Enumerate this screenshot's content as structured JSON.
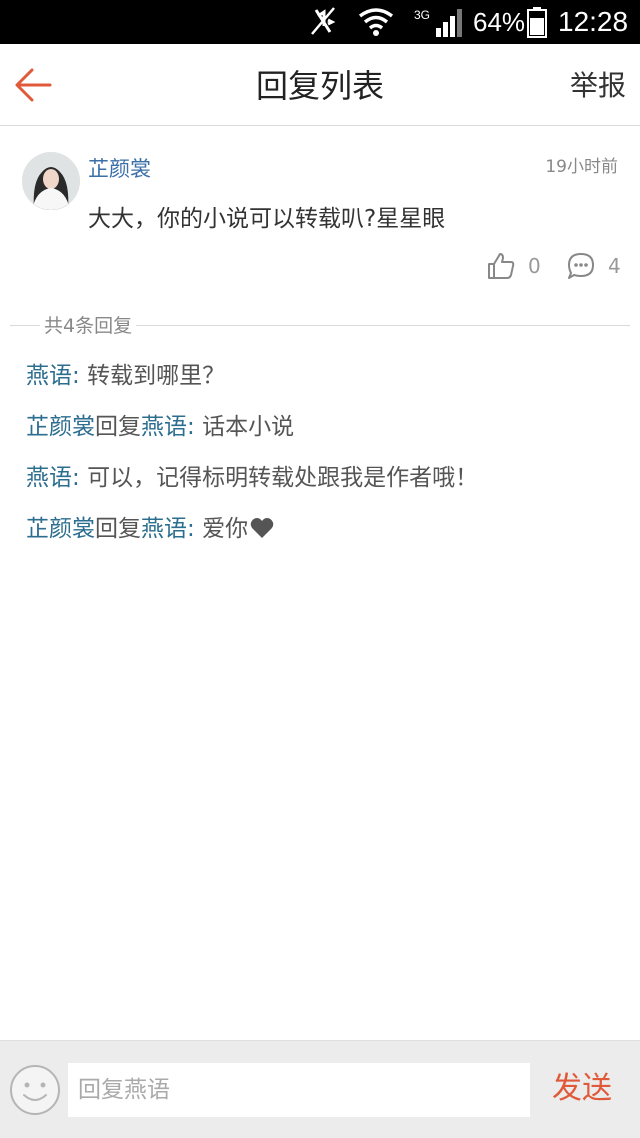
{
  "status_bar": {
    "battery_percent": "64%",
    "time": "12:28",
    "network": "3G",
    "icons": [
      "mute-icon",
      "wifi-icon",
      "signal-icon",
      "battery-icon"
    ]
  },
  "header": {
    "title": "回复列表",
    "report_label": "举报",
    "back_icon": "arrow-left-icon"
  },
  "post": {
    "author": "芷颜裳",
    "time": "19小时前",
    "content": "大大，你的小说可以转载叭?星星眼",
    "like_count": "0",
    "comment_count": "4"
  },
  "reply_section": {
    "count_label": "共4条回复"
  },
  "replies": [
    {
      "name": "燕语",
      "reply_word": "",
      "target": "",
      "colon": ": ",
      "text": "转载到哪里？"
    },
    {
      "name": "芷颜裳",
      "reply_word": "回复",
      "target": "燕语",
      "colon": ": ",
      "text": "话本小说"
    },
    {
      "name": "燕语",
      "reply_word": "",
      "target": "",
      "colon": ": ",
      "text": "可以，记得标明转载处跟我是作者哦！"
    },
    {
      "name": "芷颜裳",
      "reply_word": "回复",
      "target": "燕语",
      "colon": ": ",
      "text": "爱你"
    }
  ],
  "input_bar": {
    "placeholder": "回复燕语",
    "send_label": "发送"
  },
  "colors": {
    "accent": "#e05a3a",
    "link": "#2c6e8f",
    "author": "#3a6fa8"
  }
}
